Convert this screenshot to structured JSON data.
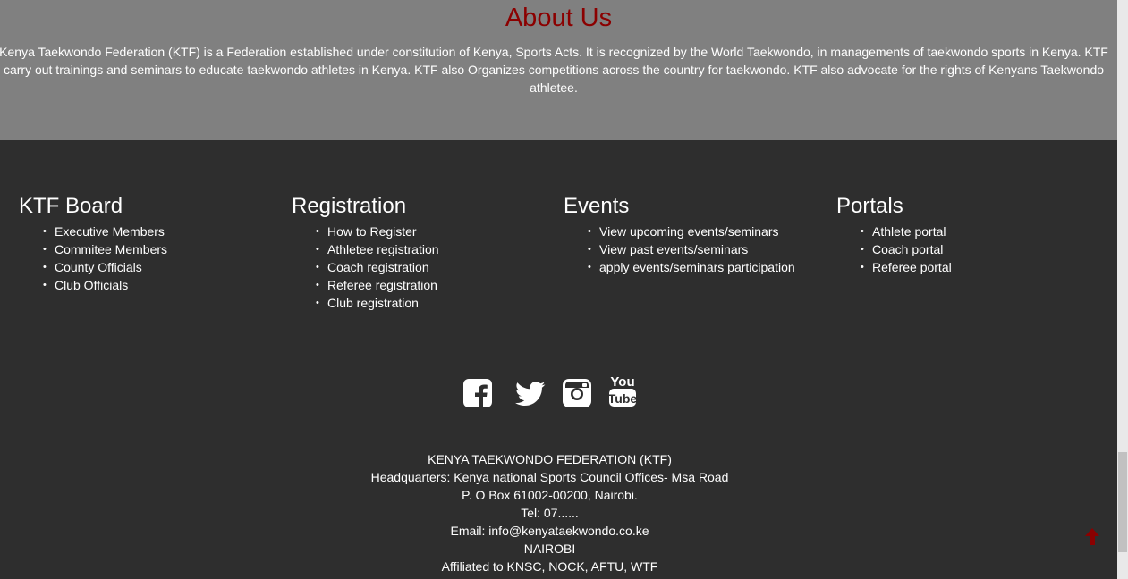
{
  "about": {
    "title": "About Us",
    "text": "Kenya Taekwondo Federation (KTF) is a Federation established under constitution of Kenya, Sports Acts. It is recognized by the World Taekwondo, in managements of taekwondo sports in Kenya. KTF carry out trainings and seminars to educate taekwondo athletes in Kenya. KTF also Organizes competitions across the country for taekwondo. KTF also advocate for the rights of Kenyans Taekwondo athletee."
  },
  "footer": {
    "columns": [
      {
        "title": "KTF Board",
        "items": [
          "Executive Members",
          "Commitee Members",
          "County Officials",
          "Club Officials"
        ]
      },
      {
        "title": "Registration",
        "items": [
          "How to Register",
          "Athletee registration",
          "Coach registration",
          "Referee registration",
          "Club registration"
        ]
      },
      {
        "title": "Events",
        "items": [
          "View upcoming events/seminars",
          "View past events/seminars",
          "apply events/seminars participation"
        ]
      },
      {
        "title": "Portals",
        "items": [
          "Athlete portal",
          "Coach portal",
          "Referee portal"
        ]
      }
    ],
    "social": [
      "facebook-icon",
      "twitter-icon",
      "instagram-icon",
      "youtube-icon"
    ],
    "contact": {
      "org": "KENYA TAEKWONDO FEDERATION (KTF)",
      "hq": "Headquarters: Kenya national Sports Council Offices- Msa Road",
      "box": "P. O Box 61002-00200, Nairobi.",
      "tel": "Tel: 07......",
      "email": "Email: info@kenyataekwondo.co.ke",
      "city": "NAIROBI",
      "affiliation": "Affiliated to KNSC, NOCK, AFTU, WTF"
    }
  },
  "colors": {
    "accent": "#8b0000",
    "about_bg": "#808080",
    "footer_bg": "#2e2e2e"
  }
}
